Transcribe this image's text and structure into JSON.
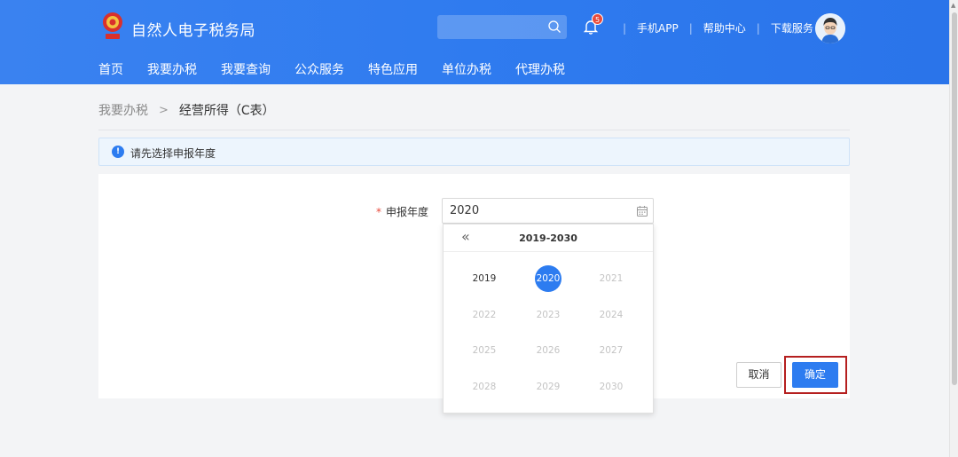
{
  "header": {
    "app_title": "自然人电子税务局",
    "badge_count": "5",
    "links": [
      "手机APP",
      "帮助中心",
      "下载服务"
    ],
    "separator": "|"
  },
  "nav": [
    "首页",
    "我要办税",
    "我要查询",
    "公众服务",
    "特色应用",
    "单位办税",
    "代理办税"
  ],
  "breadcrumb": {
    "parent": "我要办税",
    "separator": ">",
    "current": "经营所得（C表）"
  },
  "notice": {
    "icon_glyph": "!",
    "text": "请先选择申报年度"
  },
  "form": {
    "required_mark": "*",
    "label": "申报年度",
    "value": "2020"
  },
  "picker": {
    "prev_label": "«",
    "range": "2019-2030",
    "years": [
      "2019",
      "2020",
      "2021",
      "2022",
      "2023",
      "2024",
      "2025",
      "2026",
      "2027",
      "2028",
      "2029",
      "2030"
    ],
    "selected": "2020",
    "enabled": [
      "2019",
      "2020"
    ]
  },
  "buttons": {
    "cancel": "取消",
    "confirm": "确定"
  },
  "colors": {
    "header_blue": "#2f7bef",
    "primary": "#2d7cf0",
    "highlight_border": "#b51f1f",
    "badge_red": "#e84b3c"
  },
  "icons": {
    "logo": "tax-emblem-icon",
    "search": "search-icon",
    "bell": "bell-icon",
    "avatar": "user-avatar",
    "info": "info-icon",
    "calendar": "calendar-icon",
    "prev": "double-chevron-left-icon"
  }
}
